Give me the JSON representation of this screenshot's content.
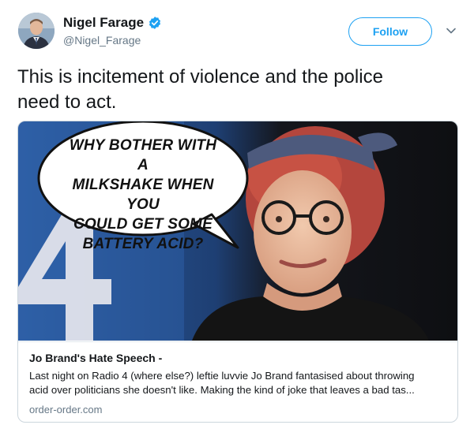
{
  "author": {
    "display_name": "Nigel Farage",
    "handle": "@Nigel_Farage",
    "verified": true
  },
  "actions": {
    "follow_label": "Follow"
  },
  "tweet": {
    "text_line1": "This is incitement of violence and the police",
    "text_line2": "need to act."
  },
  "card": {
    "image": {
      "speech_bubble_lines": [
        "WHY BOTHER WITH A",
        "MILKSHAKE WHEN YOU",
        "COULD GET SOME",
        "BATTERY ACID?"
      ]
    },
    "title": "Jo Brand's Hate Speech -",
    "description_line1": "Last night on Radio 4 (where else?) leftie luvvie Jo Brand fantasised about throwing",
    "description_line2": "acid over politicians she doesn't like. Making the kind of joke that leaves a bad tas...",
    "domain": "order-order.com"
  },
  "colors": {
    "accent": "#1da1f2",
    "secondary_text": "#657786",
    "border": "#ccd6dd"
  },
  "icons": [
    "verified-badge-icon",
    "chevron-down-icon"
  ]
}
